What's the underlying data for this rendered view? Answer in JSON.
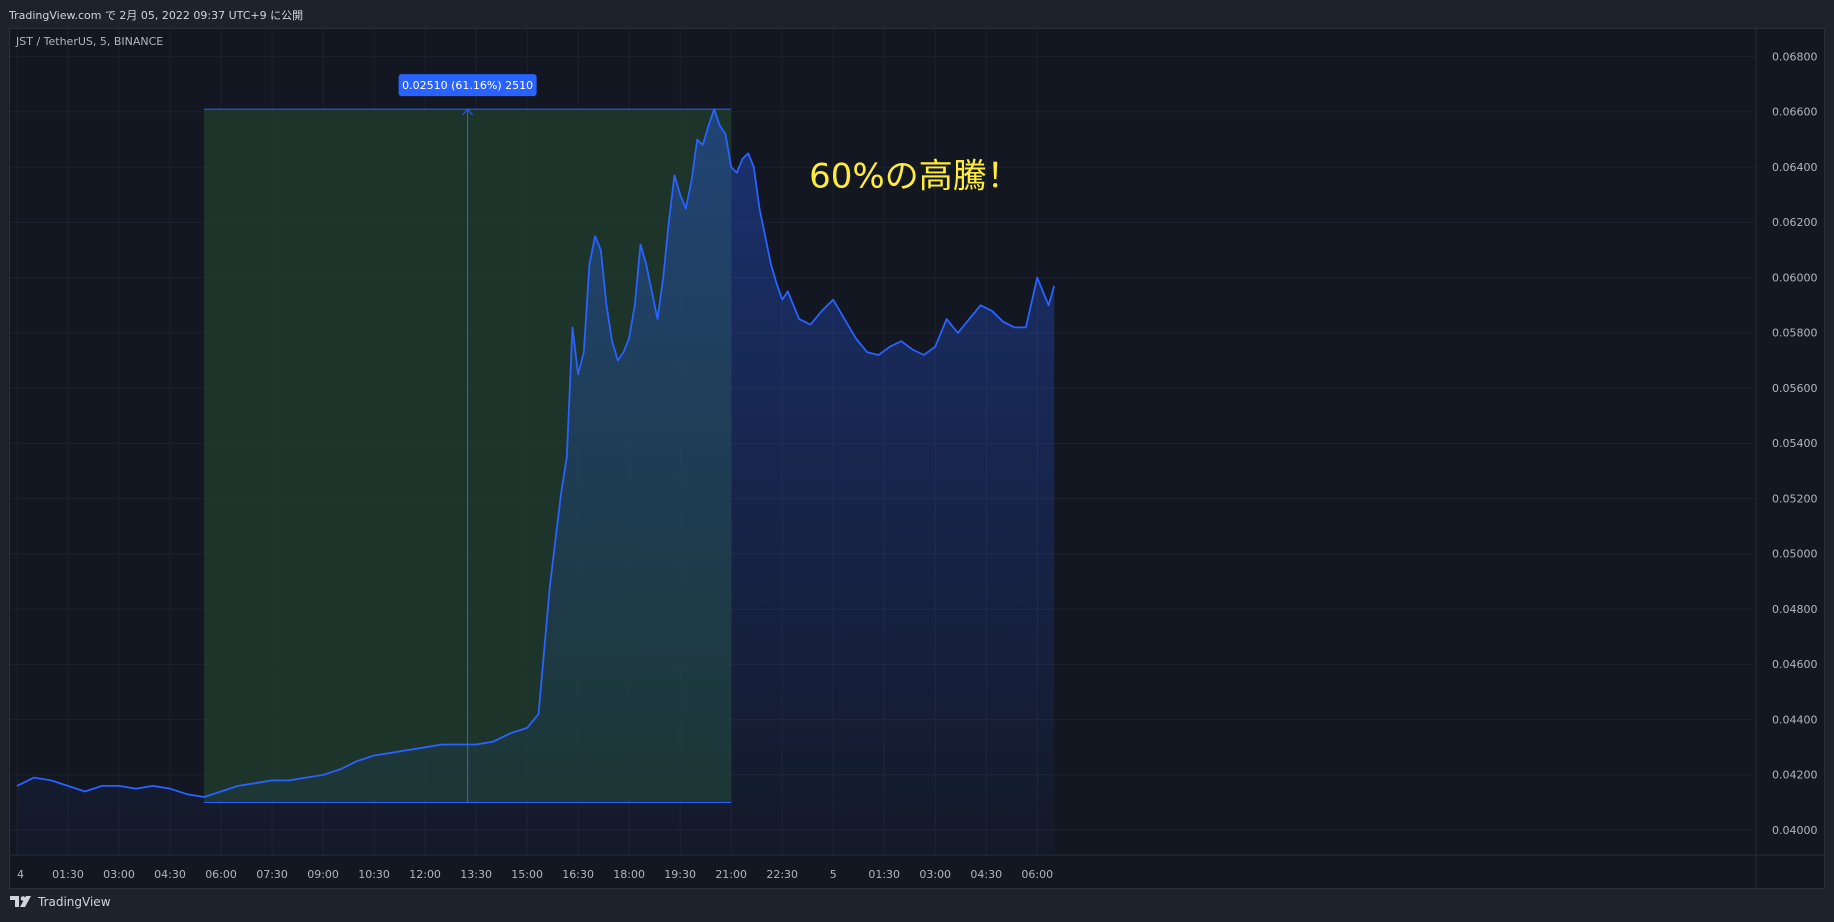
{
  "header": {
    "published": "TradingView.com で 2月 05, 2022 09:37 UTC+9 に公開"
  },
  "footer": {
    "brand": "TradingView"
  },
  "symbol": {
    "label": "JST / TetherUS, 5, BINANCE"
  },
  "annotation": {
    "text": "60%の高騰！"
  },
  "measure": {
    "label": "0.02510 (61.16%) 2510",
    "low": 0.041,
    "high": 0.0661,
    "start_x": "05:30",
    "end_x": "21:00"
  },
  "colors": {
    "line": "#2962ff",
    "measure_fill": "#1f3a2c",
    "label_bg": "#2962ff",
    "annotation": "#ffeb3b",
    "axis_text": "#b2b5be"
  },
  "chart_data": {
    "type": "area",
    "title": "JST / TetherUS, 5, BINANCE",
    "y_ticks": [
      "0.06800",
      "0.06600",
      "0.06400",
      "0.06200",
      "0.06000",
      "0.05800",
      "0.05600",
      "0.05400",
      "0.05200",
      "0.05000",
      "0.04800",
      "0.04600",
      "0.04400",
      "0.04200",
      "0.04000"
    ],
    "x_ticks": [
      "4",
      "01:30",
      "03:00",
      "04:30",
      "06:00",
      "07:30",
      "09:00",
      "10:30",
      "12:00",
      "13:30",
      "15:00",
      "16:30",
      "18:00",
      "19:30",
      "21:00",
      "22:30",
      "5",
      "01:30",
      "03:00",
      "04:30",
      "06:00"
    ],
    "ylim": [
      0.0391,
      0.069
    ],
    "x": [
      "00:00",
      "00:30",
      "01:00",
      "01:30",
      "02:00",
      "02:30",
      "03:00",
      "03:30",
      "04:00",
      "04:30",
      "05:00",
      "05:30",
      "06:00",
      "06:30",
      "07:00",
      "07:30",
      "08:00",
      "08:30",
      "09:00",
      "09:30",
      "10:00",
      "10:30",
      "11:00",
      "11:30",
      "12:00",
      "12:30",
      "13:00",
      "13:30",
      "14:00",
      "14:30",
      "15:00",
      "15:20",
      "15:40",
      "16:00",
      "16:10",
      "16:20",
      "16:30",
      "16:40",
      "16:50",
      "17:00",
      "17:10",
      "17:20",
      "17:30",
      "17:40",
      "17:50",
      "18:00",
      "18:10",
      "18:20",
      "18:30",
      "18:40",
      "18:50",
      "19:00",
      "19:10",
      "19:20",
      "19:30",
      "19:40",
      "19:50",
      "20:00",
      "20:10",
      "20:20",
      "20:30",
      "20:40",
      "20:50",
      "21:00",
      "21:10",
      "21:20",
      "21:30",
      "21:40",
      "21:50",
      "22:00",
      "22:10",
      "22:20",
      "22:30",
      "22:40",
      "22:50",
      "23:00",
      "23:20",
      "23:40",
      "00:00",
      "00:20",
      "00:40",
      "01:00",
      "01:20",
      "01:40",
      "02:00",
      "02:20",
      "02:40",
      "03:00",
      "03:20",
      "03:40",
      "04:00",
      "04:20",
      "04:40",
      "05:00",
      "05:20",
      "05:40",
      "06:00",
      "06:20",
      "06:30"
    ],
    "series": [
      {
        "values": [
          0.0416,
          0.0419,
          0.0418,
          0.0416,
          0.0414,
          0.0416,
          0.0416,
          0.0415,
          0.0416,
          0.0415,
          0.0413,
          0.0412,
          0.0414,
          0.0416,
          0.0417,
          0.0418,
          0.0418,
          0.0419,
          0.042,
          0.0422,
          0.0425,
          0.0427,
          0.0428,
          0.0429,
          0.043,
          0.0431,
          0.0431,
          0.0431,
          0.0432,
          0.0435,
          0.0437,
          0.0442,
          0.0488,
          0.0522,
          0.0535,
          0.0582,
          0.0565,
          0.0573,
          0.0605,
          0.0615,
          0.061,
          0.059,
          0.0577,
          0.057,
          0.0573,
          0.0578,
          0.059,
          0.0612,
          0.0605,
          0.0595,
          0.0585,
          0.06,
          0.062,
          0.0637,
          0.063,
          0.0625,
          0.0635,
          0.065,
          0.0648,
          0.0655,
          0.0661,
          0.0655,
          0.0652,
          0.064,
          0.0638,
          0.0643,
          0.0645,
          0.064,
          0.0625,
          0.0615,
          0.0605,
          0.0598,
          0.0592,
          0.0595,
          0.059,
          0.0585,
          0.0583,
          0.0588,
          0.0592,
          0.0585,
          0.0578,
          0.0573,
          0.0572,
          0.0575,
          0.0577,
          0.0574,
          0.0572,
          0.0575,
          0.0585,
          0.058,
          0.0585,
          0.059,
          0.0588,
          0.0584,
          0.0582,
          0.0582,
          0.06,
          0.059,
          0.0597
        ]
      }
    ]
  }
}
